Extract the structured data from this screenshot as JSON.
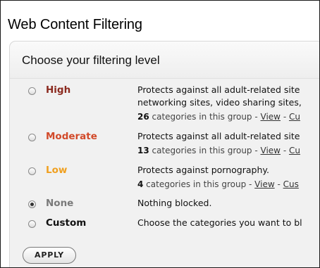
{
  "page_title": "Web Content Filtering",
  "panel": {
    "subtitle": "Choose your filtering level",
    "apply_label": "APPLY",
    "levels": [
      {
        "label": "High",
        "color": "#8b2a1f",
        "checked": false,
        "desc_line1": "Protects against all adult-related site",
        "desc_line2": "networking sites, video sharing sites,",
        "count": "26",
        "count_text": " categories in this group - ",
        "view": "View",
        "sep": " - ",
        "cu": "Cu"
      },
      {
        "label": "Moderate",
        "color": "#d24a2a",
        "checked": false,
        "desc_line1": "Protects against all adult-related site",
        "count": "13",
        "count_text": " categories in this group - ",
        "view": "View",
        "sep": " - ",
        "cu": "Cu"
      },
      {
        "label": "Low",
        "color": "#f0a020",
        "checked": false,
        "desc_line1": "Protects against pornography.",
        "count": "4",
        "count_text": " categories in this group - ",
        "view": "View",
        "sep": " - ",
        "cu": "Cus"
      },
      {
        "label": "None",
        "color": "#7a7a7a",
        "checked": true,
        "desc_line1": "Nothing blocked."
      },
      {
        "label": "Custom",
        "color": "#111111",
        "checked": false,
        "desc_line1": "Choose the categories you want to bl"
      }
    ]
  }
}
